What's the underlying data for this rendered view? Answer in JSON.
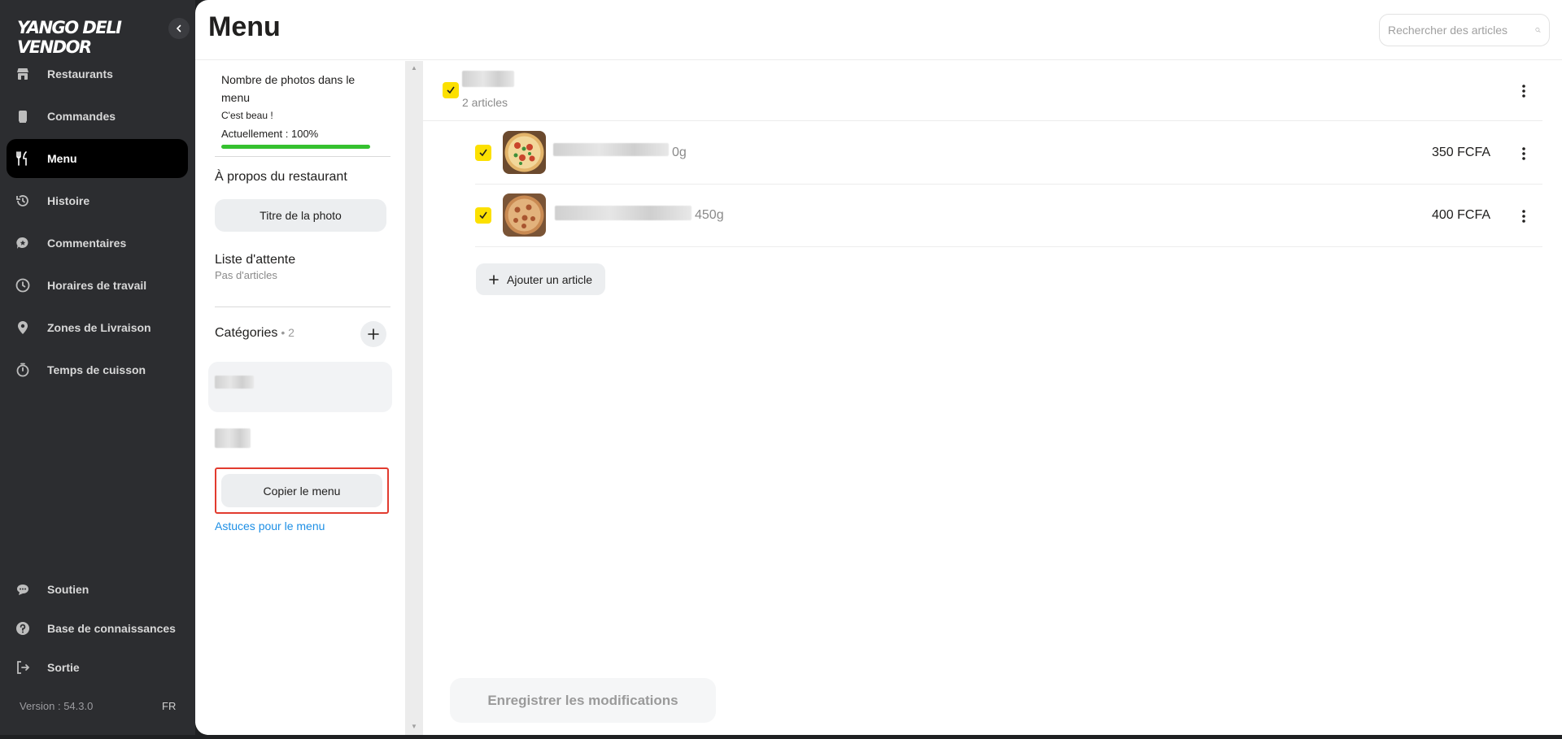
{
  "app": {
    "logo": "YANGO DELI VENDOR"
  },
  "sidebar": {
    "items": [
      {
        "label": "Restaurants",
        "icon": "store-icon",
        "active": false
      },
      {
        "label": "Commandes",
        "icon": "receipt-icon",
        "active": false
      },
      {
        "label": "Menu",
        "icon": "fork-knife-icon",
        "active": true
      },
      {
        "label": "Histoire",
        "icon": "history-icon",
        "active": false
      },
      {
        "label": "Commentaires",
        "icon": "comment-icon",
        "active": false
      },
      {
        "label": "Horaires de travail",
        "icon": "clock-icon",
        "active": false
      },
      {
        "label": "Zones de Livraison",
        "icon": "location-pin-icon",
        "active": false
      },
      {
        "label": "Temps de cuisson",
        "icon": "timer-icon",
        "active": false
      }
    ],
    "bottom_items": [
      {
        "label": "Soutien",
        "icon": "chat-icon"
      },
      {
        "label": "Base de connaissances",
        "icon": "help-icon"
      },
      {
        "label": "Sortie",
        "icon": "logout-icon"
      }
    ],
    "version": "Version : 54.3.0",
    "language": "FR"
  },
  "header": {
    "title": "Menu",
    "search_placeholder": "Rechercher des articles"
  },
  "left_pane": {
    "photo_card": {
      "title": "Nombre de photos dans le menu",
      "subtitle": "C'est beau !",
      "current": "Actuellement : 100%",
      "progress": 1.0
    },
    "about_title": "À propos du restaurant",
    "photo_button": "Titre de la photo",
    "waitlist_title": "Liste d'attente",
    "waitlist_sub": "Pas d'articles",
    "categories_title": "Catégories",
    "categories_count": "• 2",
    "copy_menu_button": "Copier le menu",
    "tips_link": "Astuces pour le menu"
  },
  "category": {
    "count_label": "2 articles",
    "items": [
      {
        "weight": "0g",
        "price": "350 FCFA"
      },
      {
        "weight": "450g",
        "price": "400 FCFA"
      }
    ],
    "add_item_label": "Ajouter un article"
  },
  "footer": {
    "save_label": "Enregistrer les modifications"
  },
  "colors": {
    "accent": "#fce000",
    "sidebar": "#2c2d30",
    "progress": "#35c12f",
    "link": "#1d8fe5",
    "highlight": "#e23b2f"
  }
}
